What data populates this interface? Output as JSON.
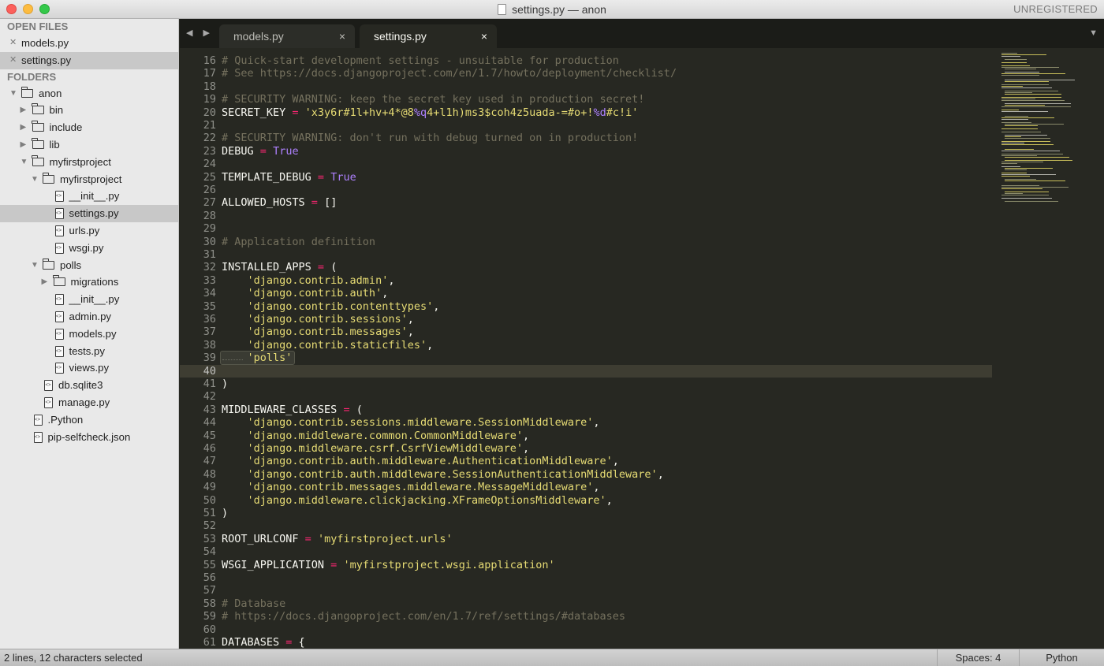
{
  "window": {
    "title": "settings.py — anon",
    "badge": "UNREGISTERED"
  },
  "sidebar": {
    "open_files_header": "OPEN FILES",
    "open_files": [
      {
        "label": "models.py",
        "selected": false
      },
      {
        "label": "settings.py",
        "selected": true
      }
    ],
    "folders_header": "FOLDERS",
    "tree": [
      {
        "label": "anon",
        "type": "folder",
        "depth": 0,
        "expanded": true
      },
      {
        "label": "bin",
        "type": "folder",
        "depth": 1,
        "expanded": false
      },
      {
        "label": "include",
        "type": "folder",
        "depth": 1,
        "expanded": false
      },
      {
        "label": "lib",
        "type": "folder",
        "depth": 1,
        "expanded": false
      },
      {
        "label": "myfirstproject",
        "type": "folder",
        "depth": 1,
        "expanded": true
      },
      {
        "label": "myfirstproject",
        "type": "folder",
        "depth": 2,
        "expanded": true
      },
      {
        "label": "__init__.py",
        "type": "file",
        "depth": 3
      },
      {
        "label": "settings.py",
        "type": "file",
        "depth": 3,
        "selected": true
      },
      {
        "label": "urls.py",
        "type": "file",
        "depth": 3
      },
      {
        "label": "wsgi.py",
        "type": "file",
        "depth": 3
      },
      {
        "label": "polls",
        "type": "folder",
        "depth": 2,
        "expanded": true
      },
      {
        "label": "migrations",
        "type": "folder",
        "depth": 3,
        "expanded": false
      },
      {
        "label": "__init__.py",
        "type": "file",
        "depth": 3
      },
      {
        "label": "admin.py",
        "type": "file",
        "depth": 3
      },
      {
        "label": "models.py",
        "type": "file",
        "depth": 3
      },
      {
        "label": "tests.py",
        "type": "file",
        "depth": 3
      },
      {
        "label": "views.py",
        "type": "file",
        "depth": 3
      },
      {
        "label": "db.sqlite3",
        "type": "file",
        "depth": 2
      },
      {
        "label": "manage.py",
        "type": "file",
        "depth": 2
      },
      {
        "label": ".Python",
        "type": "file",
        "depth": 1
      },
      {
        "label": "pip-selfcheck.json",
        "type": "file",
        "depth": 1
      }
    ]
  },
  "tabs": [
    {
      "label": "models.py",
      "close": "×",
      "active": false
    },
    {
      "label": "settings.py",
      "close": "×",
      "active": true
    }
  ],
  "tabbar": {
    "nav": "◀ ▶",
    "dropdown": "▼"
  },
  "editor": {
    "current_line": 40,
    "lines": [
      {
        "n": "16",
        "tokens": [
          {
            "t": "# Quick-start development settings - unsuitable for production",
            "c": "comment"
          }
        ]
      },
      {
        "n": "17",
        "tokens": [
          {
            "t": "# See https://docs.djangoproject.com/en/1.7/howto/deployment/checklist/",
            "c": "comment"
          }
        ]
      },
      {
        "n": "18",
        "tokens": []
      },
      {
        "n": "19",
        "tokens": [
          {
            "t": "# SECURITY WARNING: keep the secret key used in production secret!",
            "c": "comment"
          }
        ]
      },
      {
        "n": "20",
        "tokens": [
          {
            "t": "SECRET_KEY ",
            "c": ""
          },
          {
            "t": "=",
            "c": "op"
          },
          {
            "t": " 'x3y6r#1l+hv+4*@8",
            "c": "str"
          },
          {
            "t": "%q",
            "c": "esc"
          },
          {
            "t": "4+l1h)ms3$coh4z5uada-=#o+!",
            "c": "str"
          },
          {
            "t": "%d",
            "c": "esc"
          },
          {
            "t": "#c!i'",
            "c": "str"
          }
        ]
      },
      {
        "n": "21",
        "tokens": []
      },
      {
        "n": "22",
        "tokens": [
          {
            "t": "# SECURITY WARNING: don't run with debug turned on in production!",
            "c": "comment"
          }
        ]
      },
      {
        "n": "23",
        "tokens": [
          {
            "t": "DEBUG ",
            "c": ""
          },
          {
            "t": "=",
            "c": "op"
          },
          {
            "t": " ",
            "c": ""
          },
          {
            "t": "True",
            "c": "kw"
          }
        ]
      },
      {
        "n": "24",
        "tokens": []
      },
      {
        "n": "25",
        "tokens": [
          {
            "t": "TEMPLATE_DEBUG ",
            "c": ""
          },
          {
            "t": "=",
            "c": "op"
          },
          {
            "t": " ",
            "c": ""
          },
          {
            "t": "True",
            "c": "kw"
          }
        ]
      },
      {
        "n": "26",
        "tokens": []
      },
      {
        "n": "27",
        "tokens": [
          {
            "t": "ALLOWED_HOSTS ",
            "c": ""
          },
          {
            "t": "=",
            "c": "op"
          },
          {
            "t": " []",
            "c": ""
          }
        ]
      },
      {
        "n": "28",
        "tokens": []
      },
      {
        "n": "29",
        "tokens": []
      },
      {
        "n": "30",
        "tokens": [
          {
            "t": "# Application definition",
            "c": "comment"
          }
        ]
      },
      {
        "n": "31",
        "tokens": []
      },
      {
        "n": "32",
        "tokens": [
          {
            "t": "INSTALLED_APPS ",
            "c": ""
          },
          {
            "t": "=",
            "c": "op"
          },
          {
            "t": " (",
            "c": ""
          }
        ]
      },
      {
        "n": "33",
        "tokens": [
          {
            "t": "    'django.contrib.admin'",
            "c": "str"
          },
          {
            "t": ",",
            "c": ""
          }
        ]
      },
      {
        "n": "34",
        "tokens": [
          {
            "t": "    'django.contrib.auth'",
            "c": "str"
          },
          {
            "t": ",",
            "c": ""
          }
        ]
      },
      {
        "n": "35",
        "tokens": [
          {
            "t": "    'django.contrib.contenttypes'",
            "c": "str"
          },
          {
            "t": ",",
            "c": ""
          }
        ]
      },
      {
        "n": "36",
        "tokens": [
          {
            "t": "    'django.contrib.sessions'",
            "c": "str"
          },
          {
            "t": ",",
            "c": ""
          }
        ]
      },
      {
        "n": "37",
        "tokens": [
          {
            "t": "    'django.contrib.messages'",
            "c": "str"
          },
          {
            "t": ",",
            "c": ""
          }
        ]
      },
      {
        "n": "38",
        "tokens": [
          {
            "t": "    'django.contrib.staticfiles'",
            "c": "str"
          },
          {
            "t": ",",
            "c": ""
          }
        ]
      },
      {
        "n": "39",
        "tokens": [
          {
            "t": "    'polls'",
            "c": "str"
          }
        ]
      },
      {
        "n": "40",
        "tokens": []
      },
      {
        "n": "41",
        "tokens": [
          {
            "t": ")",
            "c": ""
          }
        ]
      },
      {
        "n": "42",
        "tokens": []
      },
      {
        "n": "43",
        "tokens": [
          {
            "t": "MIDDLEWARE_CLASSES ",
            "c": ""
          },
          {
            "t": "=",
            "c": "op"
          },
          {
            "t": " (",
            "c": ""
          }
        ]
      },
      {
        "n": "44",
        "tokens": [
          {
            "t": "    'django.contrib.sessions.middleware.SessionMiddleware'",
            "c": "str"
          },
          {
            "t": ",",
            "c": ""
          }
        ]
      },
      {
        "n": "45",
        "tokens": [
          {
            "t": "    'django.middleware.common.CommonMiddleware'",
            "c": "str"
          },
          {
            "t": ",",
            "c": ""
          }
        ]
      },
      {
        "n": "46",
        "tokens": [
          {
            "t": "    'django.middleware.csrf.CsrfViewMiddleware'",
            "c": "str"
          },
          {
            "t": ",",
            "c": ""
          }
        ]
      },
      {
        "n": "47",
        "tokens": [
          {
            "t": "    'django.contrib.auth.middleware.AuthenticationMiddleware'",
            "c": "str"
          },
          {
            "t": ",",
            "c": ""
          }
        ]
      },
      {
        "n": "48",
        "tokens": [
          {
            "t": "    'django.contrib.auth.middleware.SessionAuthenticationMiddleware'",
            "c": "str"
          },
          {
            "t": ",",
            "c": ""
          }
        ]
      },
      {
        "n": "49",
        "tokens": [
          {
            "t": "    'django.contrib.messages.middleware.MessageMiddleware'",
            "c": "str"
          },
          {
            "t": ",",
            "c": ""
          }
        ]
      },
      {
        "n": "50",
        "tokens": [
          {
            "t": "    'django.middleware.clickjacking.XFrameOptionsMiddleware'",
            "c": "str"
          },
          {
            "t": ",",
            "c": ""
          }
        ]
      },
      {
        "n": "51",
        "tokens": [
          {
            "t": ")",
            "c": ""
          }
        ]
      },
      {
        "n": "52",
        "tokens": []
      },
      {
        "n": "53",
        "tokens": [
          {
            "t": "ROOT_URLCONF ",
            "c": ""
          },
          {
            "t": "=",
            "c": "op"
          },
          {
            "t": " ",
            "c": ""
          },
          {
            "t": "'myfirstproject.urls'",
            "c": "str"
          }
        ]
      },
      {
        "n": "54",
        "tokens": []
      },
      {
        "n": "55",
        "tokens": [
          {
            "t": "WSGI_APPLICATION ",
            "c": ""
          },
          {
            "t": "=",
            "c": "op"
          },
          {
            "t": " ",
            "c": ""
          },
          {
            "t": "'myfirstproject.wsgi.application'",
            "c": "str"
          }
        ]
      },
      {
        "n": "56",
        "tokens": []
      },
      {
        "n": "57",
        "tokens": []
      },
      {
        "n": "58",
        "tokens": [
          {
            "t": "# Database",
            "c": "comment"
          }
        ]
      },
      {
        "n": "59",
        "tokens": [
          {
            "t": "# https://docs.djangoproject.com/en/1.7/ref/settings/#databases",
            "c": "comment"
          }
        ]
      },
      {
        "n": "60",
        "tokens": []
      },
      {
        "n": "61",
        "tokens": [
          {
            "t": "DATABASES ",
            "c": ""
          },
          {
            "t": "=",
            "c": "op"
          },
          {
            "t": " {",
            "c": ""
          }
        ]
      }
    ]
  },
  "statusbar": {
    "selection": "2 lines, 12 characters selected",
    "indentation": "Spaces: 4",
    "syntax": "Python"
  },
  "colors": {
    "background": "#272822",
    "comment": "#75715e",
    "string": "#e6db74",
    "operator": "#f92672",
    "constant": "#ae81ff",
    "foreground": "#f8f8f2"
  }
}
